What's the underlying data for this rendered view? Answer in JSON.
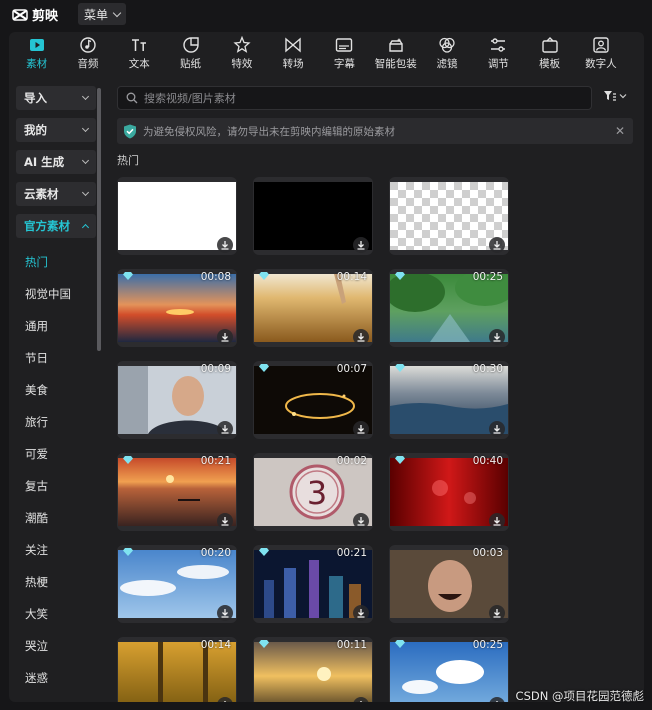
{
  "app": {
    "name": "剪映",
    "menu_label": "菜单"
  },
  "toolbar": [
    {
      "label": "素材",
      "icon": "media-icon",
      "active": true
    },
    {
      "label": "音频",
      "icon": "audio-icon",
      "active": false
    },
    {
      "label": "文本",
      "icon": "text-icon",
      "active": false
    },
    {
      "label": "贴纸",
      "icon": "sticker-icon",
      "active": false
    },
    {
      "label": "特效",
      "icon": "effects-icon",
      "active": false
    },
    {
      "label": "转场",
      "icon": "transition-icon",
      "active": false
    },
    {
      "label": "字幕",
      "icon": "subtitle-icon",
      "active": false
    },
    {
      "label": "智能包装",
      "icon": "smart-pack-icon",
      "active": false
    },
    {
      "label": "滤镜",
      "icon": "filter-icon",
      "active": false
    },
    {
      "label": "调节",
      "icon": "adjust-icon",
      "active": false
    },
    {
      "label": "模板",
      "icon": "template-icon",
      "active": false
    },
    {
      "label": "数字人",
      "icon": "digital-human-icon",
      "active": false
    }
  ],
  "sidebar": {
    "groups": [
      {
        "label": "导入",
        "active": false
      },
      {
        "label": "我的",
        "active": false
      },
      {
        "label": "AI 生成",
        "active": false
      },
      {
        "label": "云素材",
        "active": false
      },
      {
        "label": "官方素材",
        "active": true
      }
    ],
    "items": [
      {
        "label": "热门",
        "active": true
      },
      {
        "label": "视觉中国",
        "active": false
      },
      {
        "label": "通用",
        "active": false
      },
      {
        "label": "节日",
        "active": false
      },
      {
        "label": "美食",
        "active": false
      },
      {
        "label": "旅行",
        "active": false
      },
      {
        "label": "可爱",
        "active": false
      },
      {
        "label": "复古",
        "active": false
      },
      {
        "label": "潮酷",
        "active": false
      },
      {
        "label": "关注",
        "active": false
      },
      {
        "label": "热梗",
        "active": false
      },
      {
        "label": "大笑",
        "active": false
      },
      {
        "label": "哭泣",
        "active": false
      },
      {
        "label": "迷惑",
        "active": false
      }
    ]
  },
  "search": {
    "placeholder": "搜索视频/图片素材"
  },
  "notice": {
    "text": "为避免侵权风险，请勿导出未在剪映内编辑的原始素材"
  },
  "section": {
    "title": "热门"
  },
  "tiles": [
    {
      "name": "white",
      "duration": "",
      "premium": false
    },
    {
      "name": "black",
      "duration": "",
      "premium": false
    },
    {
      "name": "transparent",
      "duration": "",
      "premium": false
    },
    {
      "name": "sunset-sea",
      "duration": "00:08",
      "premium": true
    },
    {
      "name": "wheat-field",
      "duration": "00:14",
      "premium": true
    },
    {
      "name": "forest-river",
      "duration": "00:25",
      "premium": true
    },
    {
      "name": "man-face",
      "duration": "00:09",
      "premium": false
    },
    {
      "name": "gold-sparks",
      "duration": "00:07",
      "premium": true
    },
    {
      "name": "ocean-waves",
      "duration": "00:30",
      "premium": true
    },
    {
      "name": "rowing-sunset",
      "duration": "00:21",
      "premium": true
    },
    {
      "name": "countdown-3",
      "duration": "00:02",
      "premium": false
    },
    {
      "name": "red-curtain",
      "duration": "00:40",
      "premium": true
    },
    {
      "name": "blue-sky",
      "duration": "00:20",
      "premium": true
    },
    {
      "name": "city-night",
      "duration": "00:21",
      "premium": true
    },
    {
      "name": "laughing-man",
      "duration": "00:03",
      "premium": false
    },
    {
      "name": "autumn-trees",
      "duration": "00:14",
      "premium": false
    },
    {
      "name": "golden-sunset",
      "duration": "00:11",
      "premium": true
    },
    {
      "name": "clouds-sky",
      "duration": "00:25",
      "premium": true
    }
  ],
  "watermark": "CSDN @项目花园范德彪",
  "colors": {
    "accent": "#25c5d3",
    "panel": "#1f1f21",
    "background": "#161618"
  }
}
